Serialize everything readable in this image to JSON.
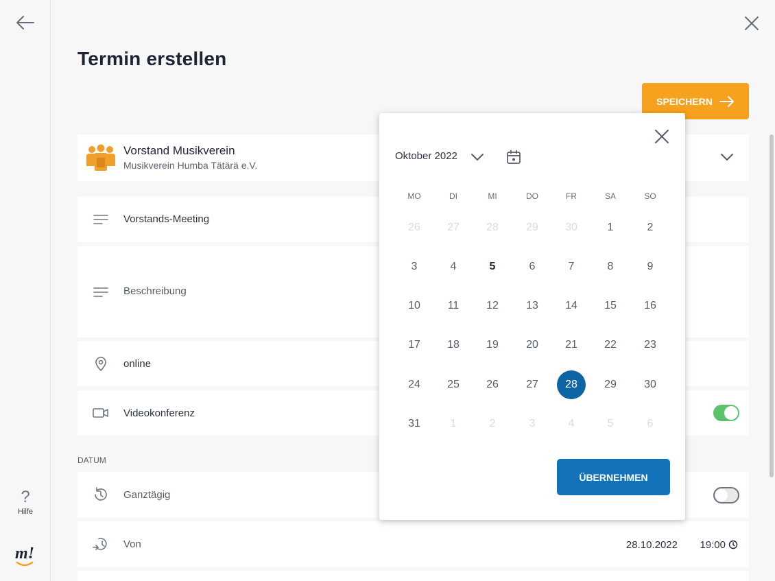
{
  "sidebar": {
    "help_label": "Hilfe",
    "logo_text": "m!"
  },
  "header": {
    "title": "Termin erstellen",
    "save_label": "SPEICHERN"
  },
  "organization": {
    "name": "Vorstand Musikverein",
    "subtitle": "Musikverein Humba Tätärä e.V."
  },
  "form": {
    "title_value": "Vorstands-Meeting",
    "description_placeholder": "Beschreibung",
    "location_value": "online",
    "video_label": "Videokonferenz",
    "video_enabled": true,
    "date_section_label": "DATUM",
    "all_day_label": "Ganztägig",
    "all_day_enabled": false,
    "from_label": "Von",
    "from_date": "28.10.2022",
    "from_time": "19:00"
  },
  "datepicker": {
    "month_label": "Oktober 2022",
    "weekdays": [
      "MO",
      "DI",
      "MI",
      "DO",
      "FR",
      "SA",
      "SO"
    ],
    "weeks": [
      [
        "26",
        "27",
        "28",
        "29",
        "30",
        "1",
        "2"
      ],
      [
        "3",
        "4",
        "5",
        "6",
        "7",
        "8",
        "9"
      ],
      [
        "10",
        "11",
        "12",
        "13",
        "14",
        "15",
        "16"
      ],
      [
        "17",
        "18",
        "19",
        "20",
        "21",
        "22",
        "23"
      ],
      [
        "24",
        "25",
        "26",
        "27",
        "28",
        "29",
        "30"
      ],
      [
        "31",
        "1",
        "2",
        "3",
        "4",
        "5",
        "6"
      ]
    ],
    "today": "5",
    "selected": "28",
    "apply_label": "ÜBERNEHMEN"
  },
  "colors": {
    "save_button": "#f6a21e",
    "apply_button": "#1273bb",
    "selected_day": "#0f64a4",
    "toggle_on": "#5cc26a",
    "brand_icon": "#f0a02a"
  }
}
